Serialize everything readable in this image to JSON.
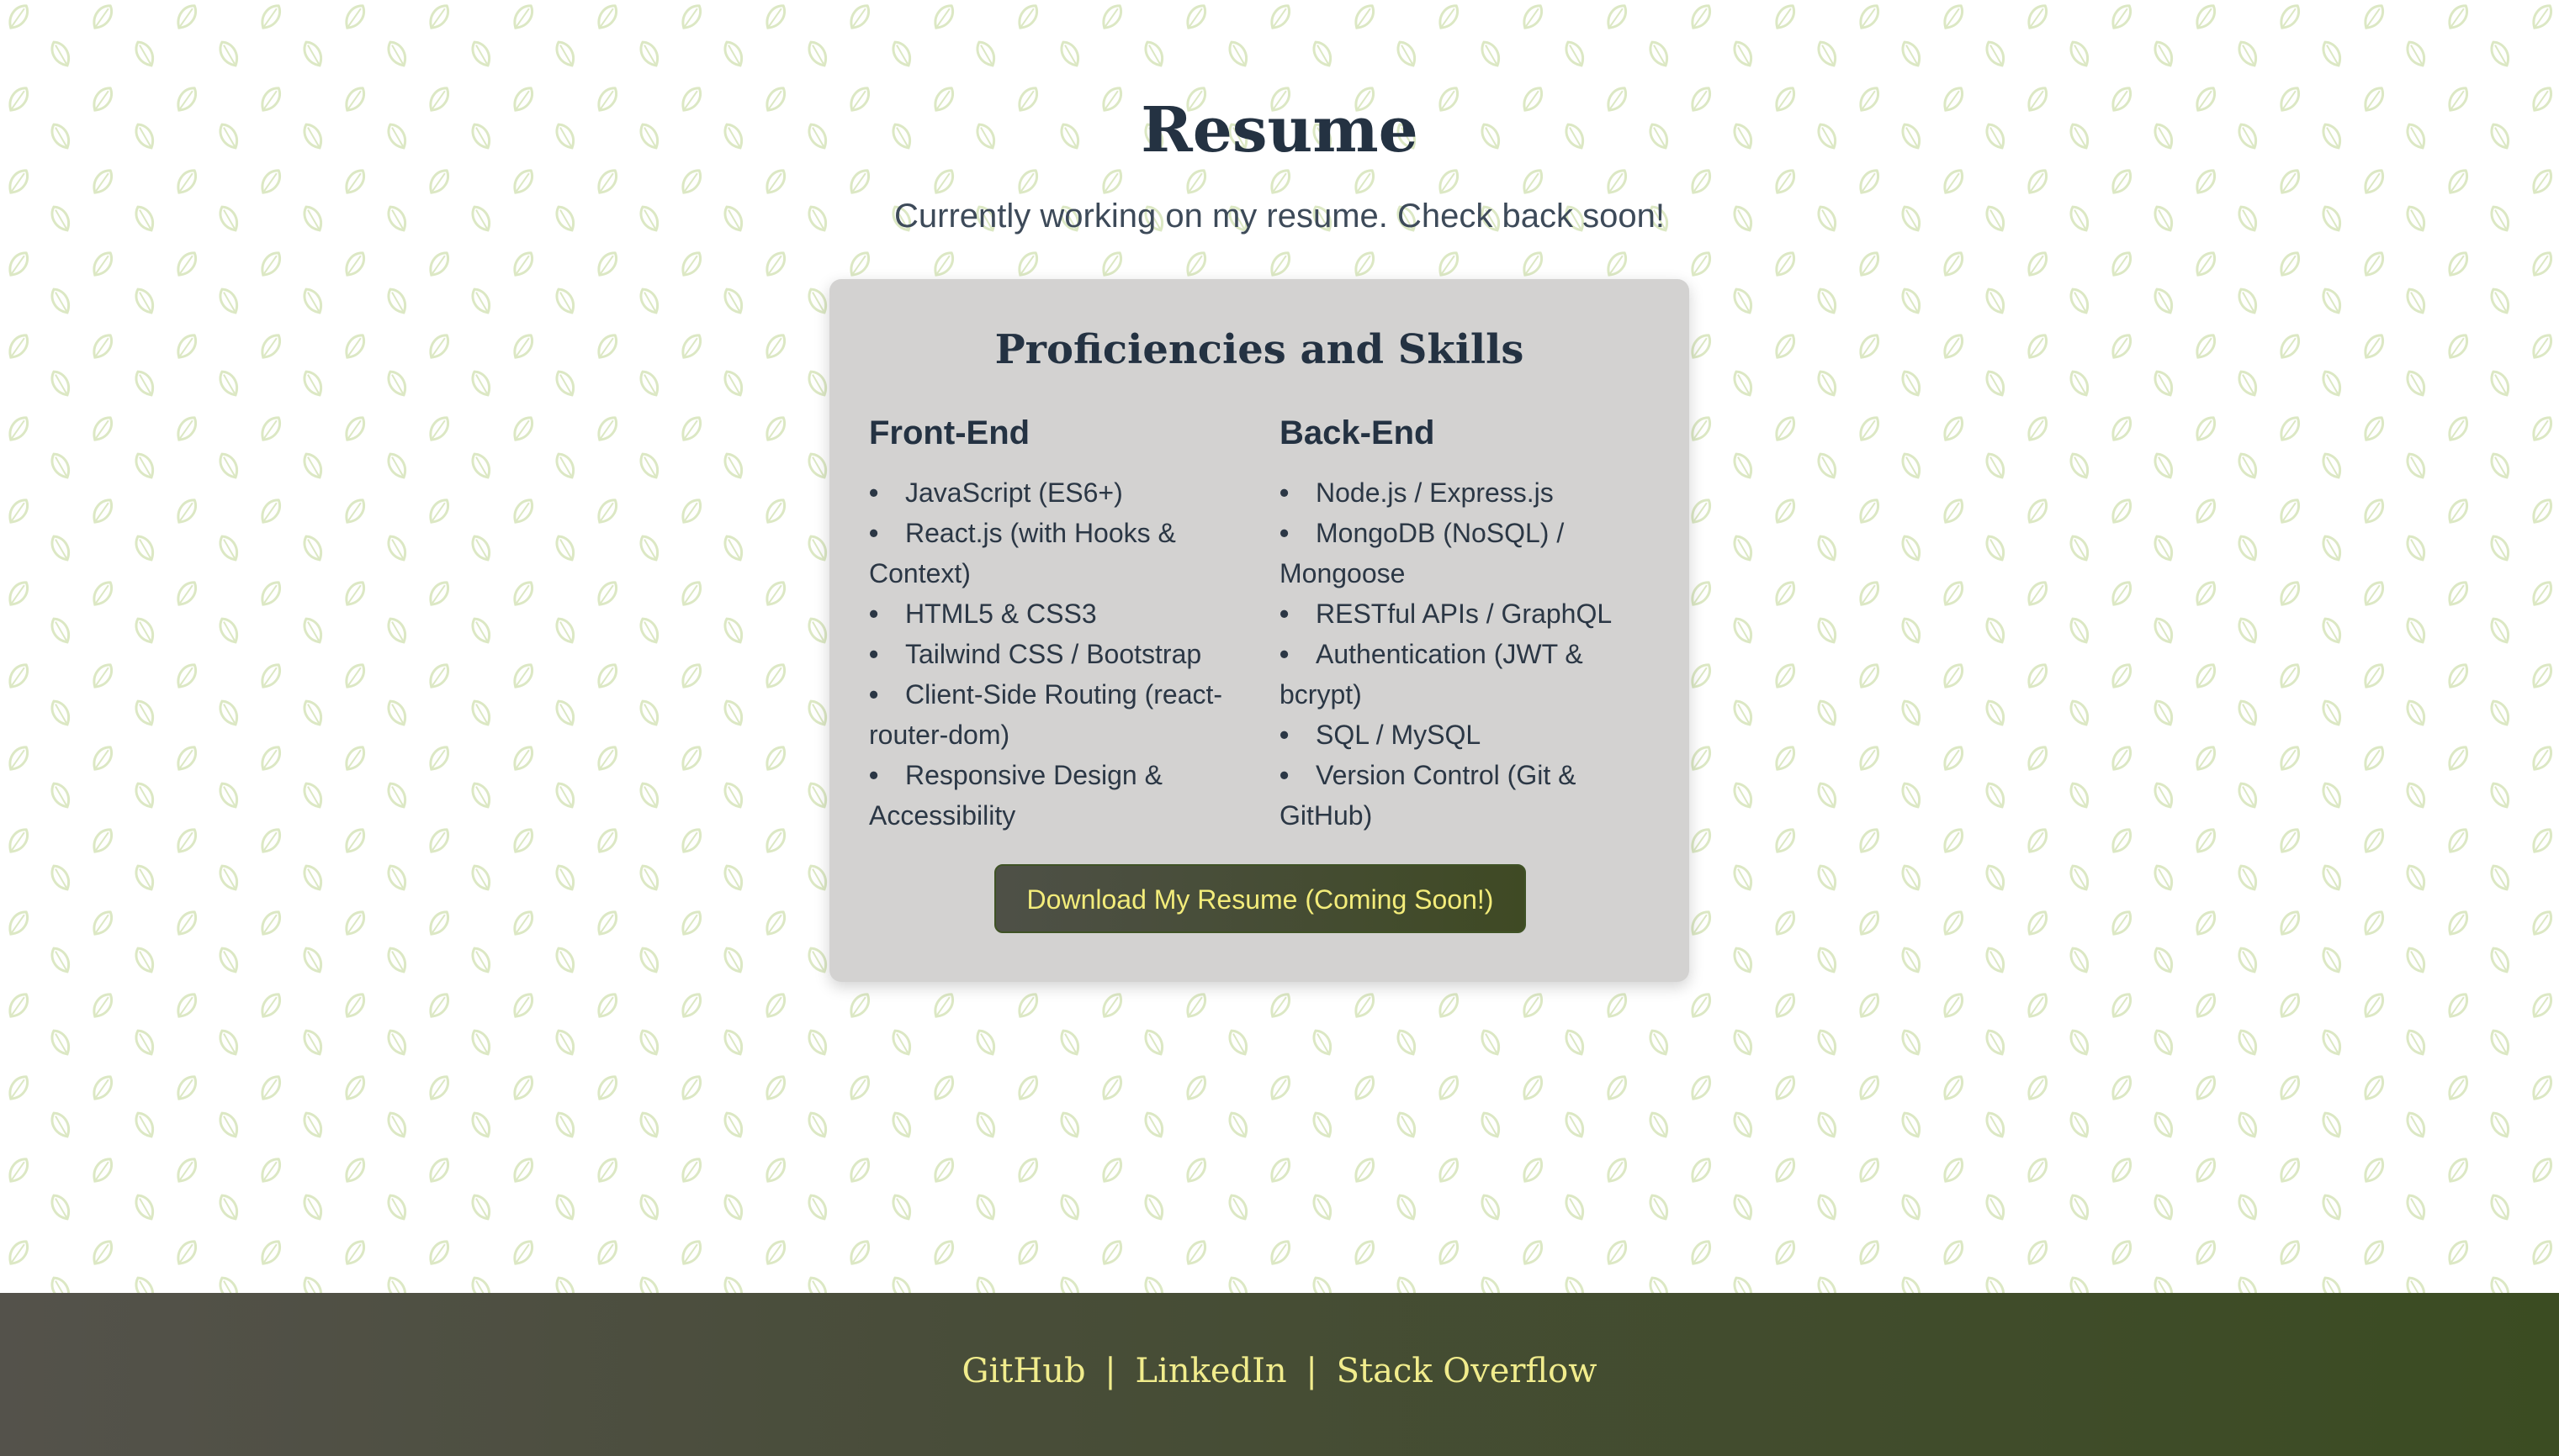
{
  "page": {
    "title": "Resume",
    "subtitle": "Currently working on my resume. Check back soon!"
  },
  "card": {
    "title": "Proficiencies and Skills",
    "columns": [
      {
        "title": "Front-End",
        "items": [
          "JavaScript (ES6+)",
          "React.js (with Hooks & Context)",
          "HTML5 & CSS3",
          "Tailwind CSS / Bootstrap",
          "Client-Side Routing (react-router-dom)",
          "Responsive Design & Accessibility"
        ]
      },
      {
        "title": "Back-End",
        "items": [
          "Node.js / Express.js",
          "MongoDB (NoSQL) / Mongoose",
          "RESTful APIs / GraphQL",
          "Authentication (JWT & bcrypt)",
          "SQL / MySQL",
          "Version Control (Git & GitHub)"
        ]
      }
    ],
    "download_button": "Download My Resume (Coming Soon!)"
  },
  "footer": {
    "links": [
      "GitHub",
      "LinkedIn",
      "Stack Overflow"
    ],
    "separator": "|"
  },
  "icons": {
    "background_pattern": "leaf-icon",
    "bullet": "•"
  },
  "colors": {
    "heading": "#243242",
    "card_background": "#d3d2d1",
    "button_text": "#f3ec7a",
    "footer_text": "#f1ec8c",
    "pattern_leaf": "#dce8c4"
  }
}
